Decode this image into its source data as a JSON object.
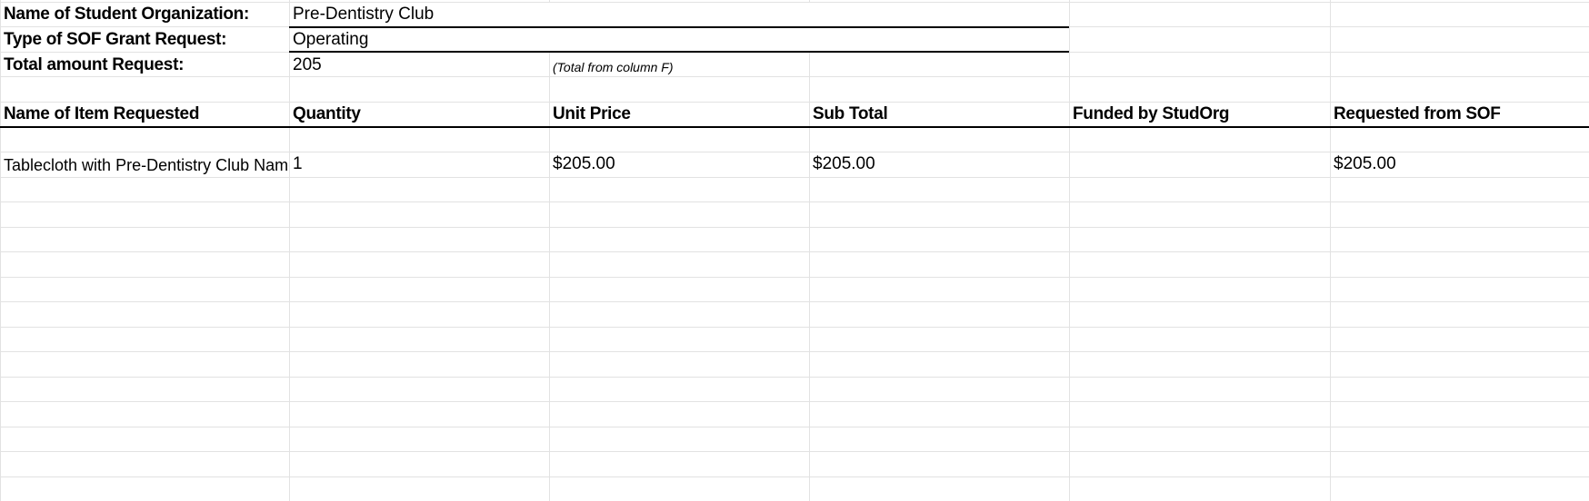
{
  "meta": {
    "org_label": "Name of Student Organization:",
    "org_value": "Pre-Dentistry Club",
    "type_label": "Type of SOF Grant Request:",
    "type_value": "Operating",
    "total_label": "Total amount Request:",
    "total_value": "205",
    "total_note": "(Total from column F)"
  },
  "table": {
    "headers": [
      "Name of Item Requested",
      "Quantity",
      "Unit Price",
      "Sub Total",
      "Funded by StudOrg",
      "Requested from SOF"
    ],
    "rows": [
      {
        "item": "Tablecloth with Pre-Dentistry Club Name",
        "quantity": "1",
        "unit_price": "$205.00",
        "sub_total": "$205.00",
        "funded_by_studorg": "",
        "requested_from_sof": "$205.00"
      }
    ]
  }
}
